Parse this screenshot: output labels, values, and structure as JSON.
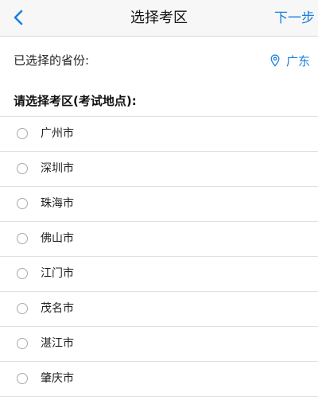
{
  "colors": {
    "accent": "#1a7fe0",
    "navbar_bg": "#f7f7f7",
    "divider": "#e1e1e1"
  },
  "navbar": {
    "back_icon": "chevron-left-icon",
    "title": "选择考区",
    "next_label": "下一步"
  },
  "province": {
    "label": "已选择的省份:",
    "icon": "location-pin-icon",
    "value": "广东"
  },
  "section": {
    "title": "请选择考区(考试地点):"
  },
  "cities": [
    {
      "name": "广州市",
      "selected": false
    },
    {
      "name": "深圳市",
      "selected": false
    },
    {
      "name": "珠海市",
      "selected": false
    },
    {
      "name": "佛山市",
      "selected": false
    },
    {
      "name": "江门市",
      "selected": false
    },
    {
      "name": "茂名市",
      "selected": false
    },
    {
      "name": "湛江市",
      "selected": false
    },
    {
      "name": "肇庆市",
      "selected": false
    }
  ]
}
